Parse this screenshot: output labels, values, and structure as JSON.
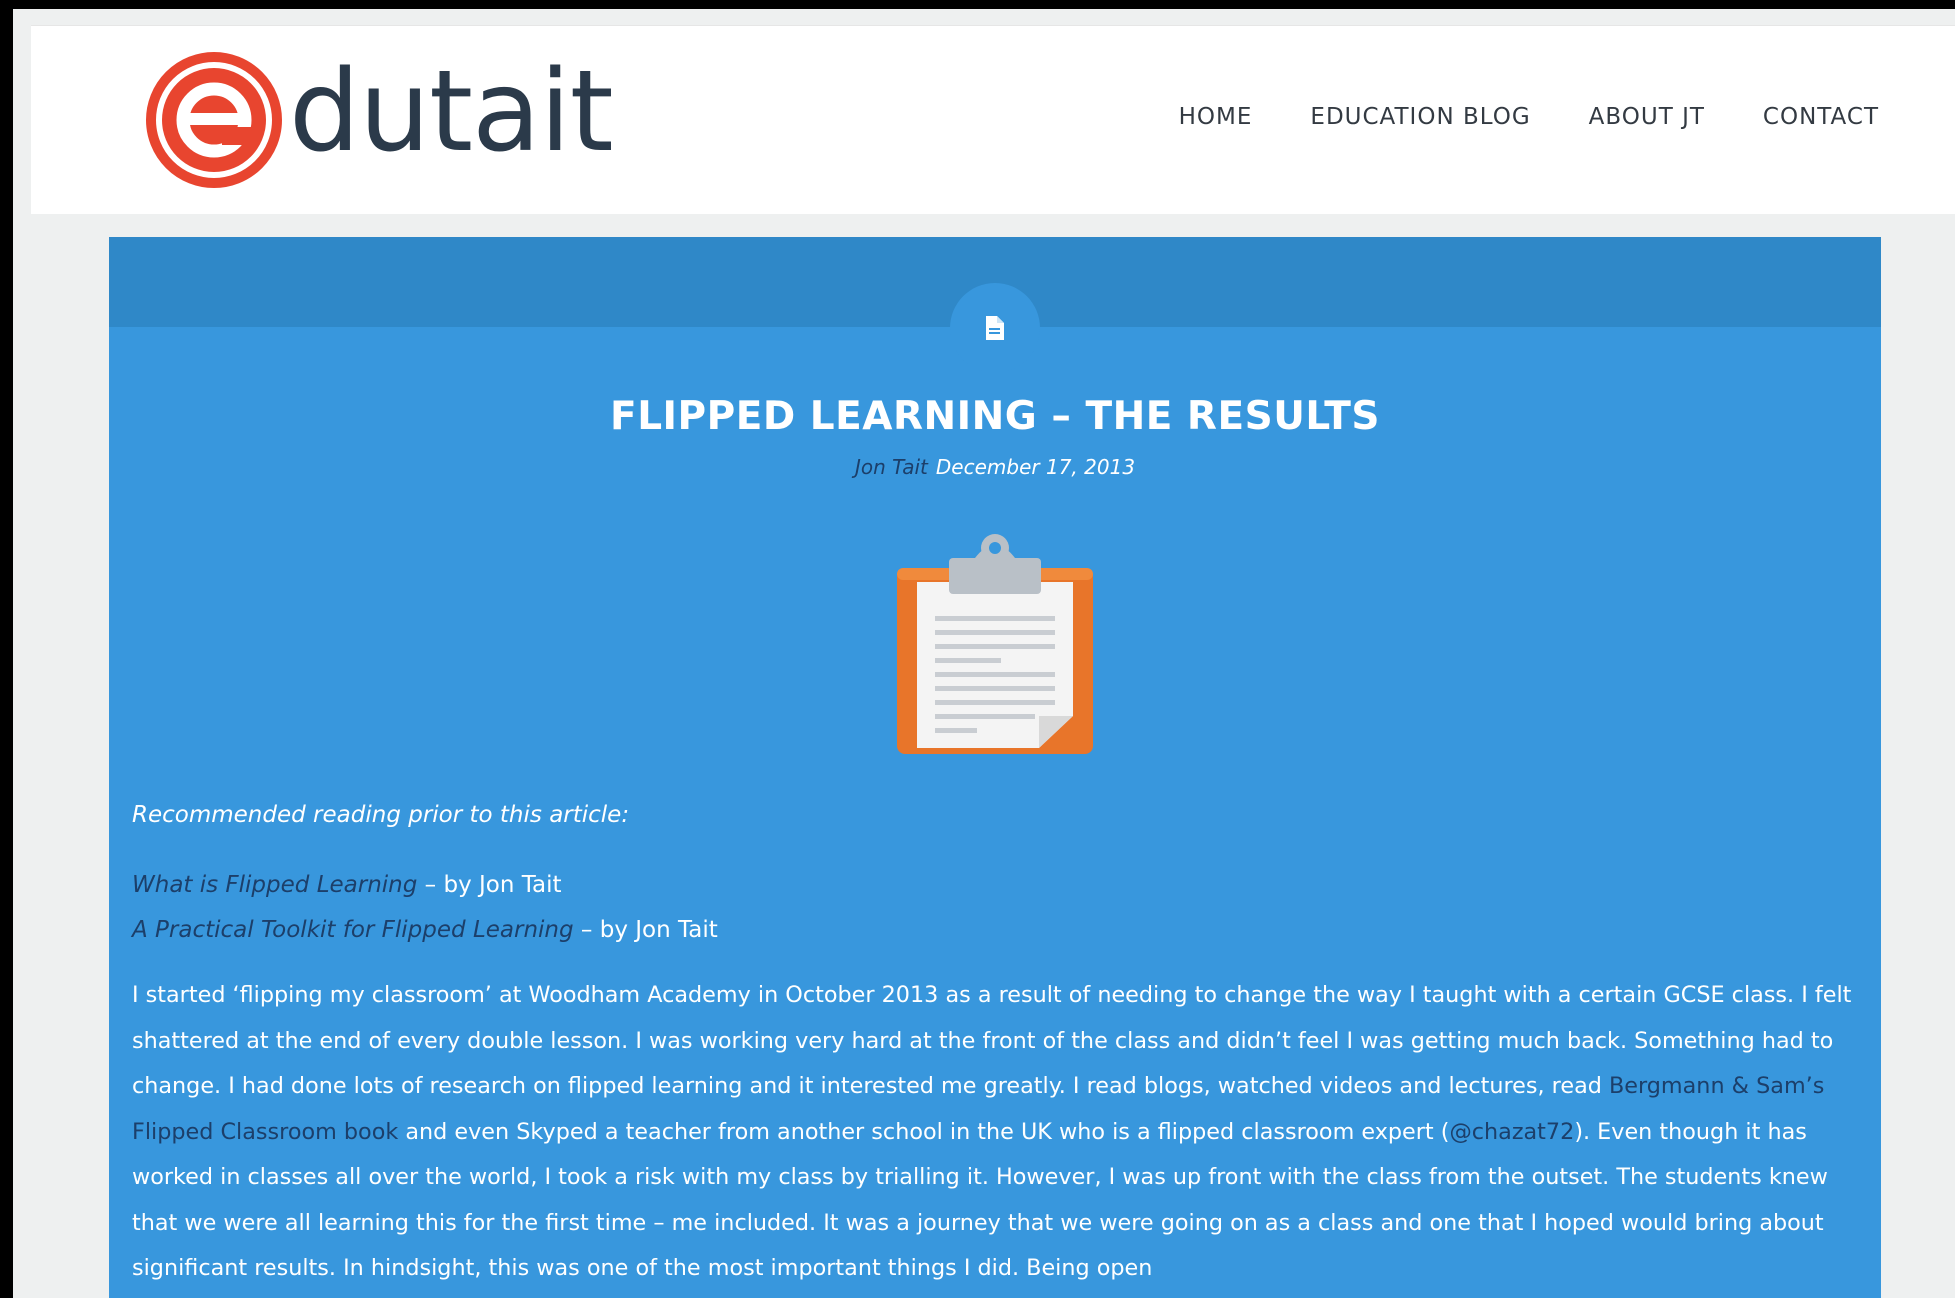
{
  "header": {
    "logo_text": "dutait",
    "nav": [
      "HOME",
      "EDUCATION BLOG",
      "ABOUT JT",
      "CONTACT"
    ]
  },
  "post": {
    "title": "FLIPPED LEARNING – THE RESULTS",
    "author": "Jon Tait",
    "date": "December 17, 2013",
    "icon": "document-icon",
    "image": "clipboard-icon"
  },
  "content": {
    "recommended": "Recommended reading prior to this article:",
    "reading": [
      {
        "link": "What is Flipped Learning",
        "suffix": " – by Jon Tait"
      },
      {
        "link": "A Practical Toolkit for Flipped Learning",
        "suffix": " – by Jon Tait"
      }
    ],
    "body": {
      "part1": "I started ‘flipping my classroom’ at Woodham Academy in October 2013 as a result of needing to change the way I taught with a certain GCSE class. I felt shattered at the end of every double lesson. I was working very hard at the front of the class and didn’t feel I was getting much back. Something had to change. I had done lots of research on flipped learning and it interested me greatly. I read blogs, watched videos and lectures, read ",
      "link1": "Bergmann & Sam’s Flipped Classroom book",
      "part2": " and even Skyped a teacher from another school in the UK who is a flipped classroom expert (",
      "link2": "@chazat72",
      "part3": "). Even though it has worked in classes all over the world, I took a risk with my class by trialling it. However, I was up front with the class from the outset. The students knew that we were all learning this for the first time – me included. It was a journey that we were going on as a class and one that I hoped would bring about significant results. In hindsight, this was one of the most important things I did. Being open"
    }
  },
  "colors": {
    "card": "#3897dd",
    "card_band": "#2f88c8",
    "logo_red": "#e8452f",
    "logo_text": "#2b3a4a",
    "link": "#1c3f6a"
  }
}
